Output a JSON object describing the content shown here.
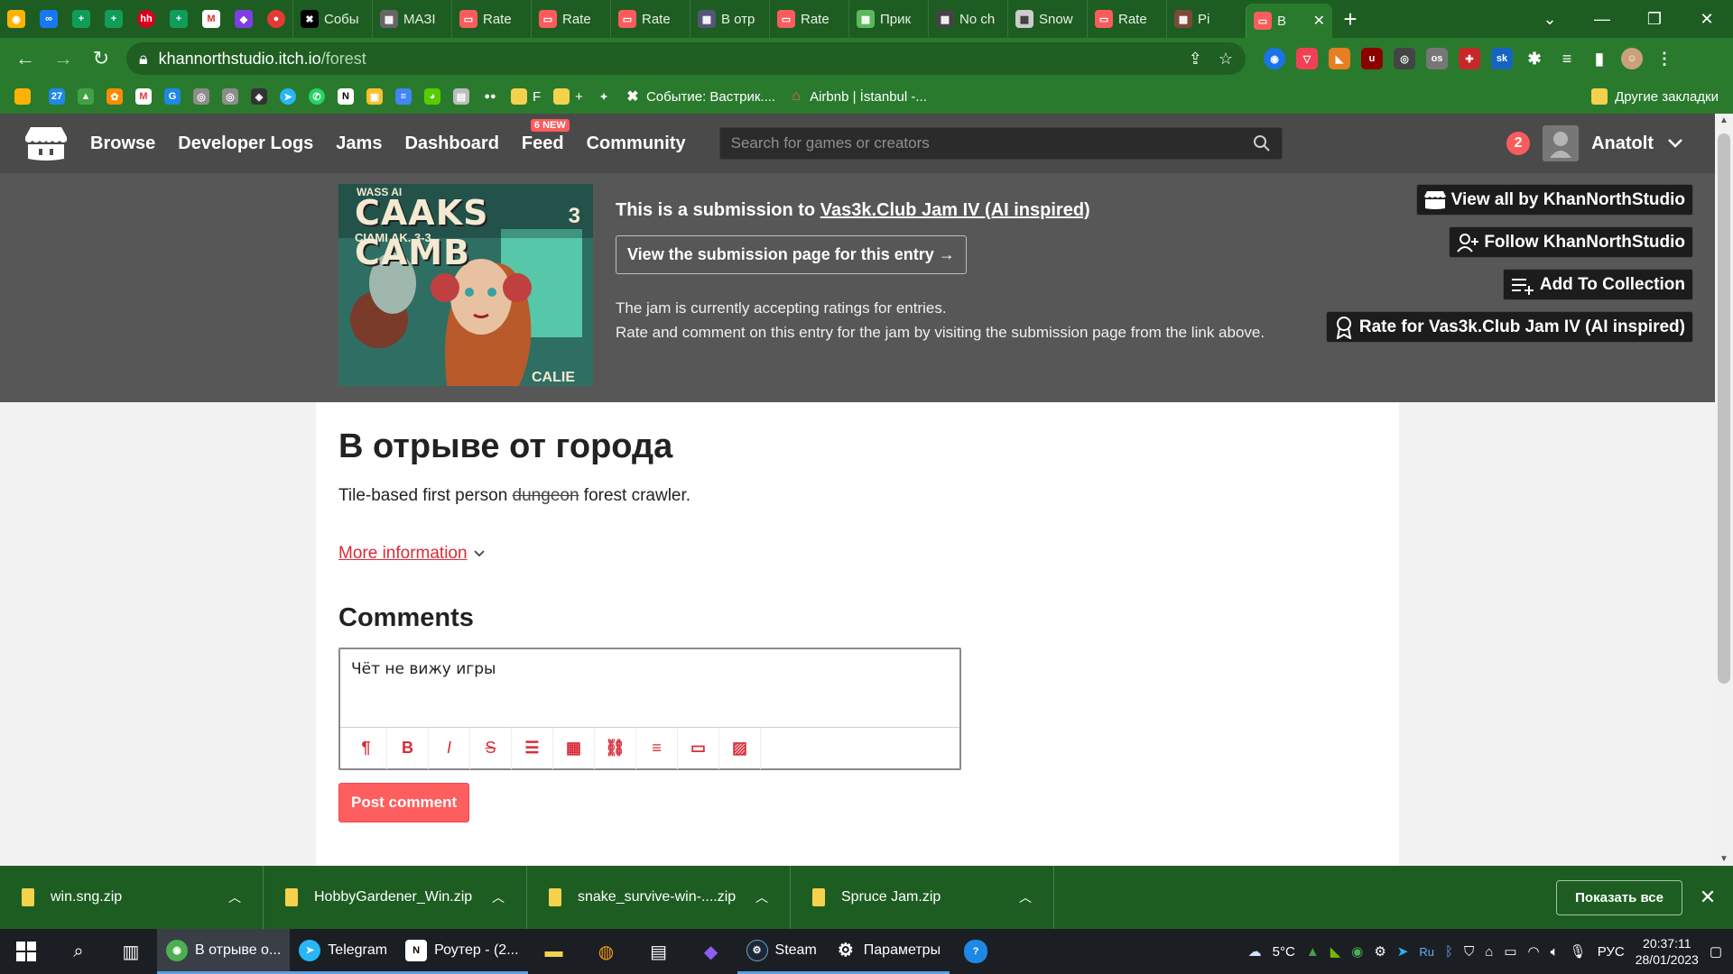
{
  "browser": {
    "pinned_count": 5,
    "tabs": [
      {
        "label": "Собы",
        "icon": "close-icon"
      },
      {
        "label": "МАЗІ",
        "icon": "image-icon"
      },
      {
        "label": "Rate",
        "icon": "itch-icon"
      },
      {
        "label": "Rate",
        "icon": "itch-icon"
      },
      {
        "label": "Rate",
        "icon": "itch-icon"
      },
      {
        "label": "В отр",
        "icon": "image-icon"
      },
      {
        "label": "Rate",
        "icon": "itch-icon"
      },
      {
        "label": "Прик",
        "icon": "image-icon"
      },
      {
        "label": "No ch",
        "icon": "image-icon"
      },
      {
        "label": "Snow",
        "icon": "image-icon"
      },
      {
        "label": "Rate",
        "icon": "itch-icon"
      },
      {
        "label": "Pi",
        "icon": "image-icon"
      },
      {
        "label": "B",
        "icon": "itch-icon",
        "active": true
      }
    ],
    "url_host": "khannorthstudio.itch.io",
    "url_path": "/forest",
    "bookmarks": [
      {
        "label": "",
        "color": "#ffb300"
      },
      {
        "label": "",
        "color": "#1e88e5"
      },
      {
        "label": "",
        "color": "#43a047"
      },
      {
        "label": "",
        "color": "#fb8c00"
      },
      {
        "label": "",
        "color": "#e53935"
      },
      {
        "label": "",
        "color": "#1e88e5"
      },
      {
        "label": "",
        "color": "#8d8d8d"
      },
      {
        "label": "",
        "color": "#8d8d8d"
      },
      {
        "label": "",
        "color": "#333"
      },
      {
        "label": "",
        "color": "#29b6f6"
      },
      {
        "label": "",
        "color": "#25d366"
      },
      {
        "label": "",
        "color": "#000"
      },
      {
        "label": "",
        "color": "#fbc02d"
      },
      {
        "label": "",
        "color": "#4285f4"
      },
      {
        "label": "",
        "color": "#58cc02"
      },
      {
        "label": "",
        "color": "#bdbdbd"
      },
      {
        "label": "",
        "color": "#555"
      },
      {
        "label": "F",
        "color": "#f6d24c"
      },
      {
        "label": "+",
        "color": "#f6d24c"
      },
      {
        "label": "",
        "color": "#888"
      },
      {
        "label": "Событие: Вастрик....",
        "color": "#000"
      },
      {
        "label": "Airbnb | İstanbul -...",
        "color": "#ff5a5f"
      }
    ],
    "other_bookmarks": "Другие закладки"
  },
  "itch": {
    "nav": [
      "Browse",
      "Developer Logs",
      "Jams",
      "Dashboard",
      "Feed",
      "Community"
    ],
    "feed_badge": "6 NEW",
    "search_placeholder": "Search for games or creators",
    "notifications": "2",
    "username": "Anatolt"
  },
  "jam": {
    "cover": {
      "top": "WASS AI",
      "title": "CAAKS CAMB",
      "number": "3",
      "sub": "CIAMI AK. 3-3",
      "bottom": "CALIE"
    },
    "submission_prefix": "This is a submission to ",
    "jam_name": "Vas3k.Club Jam IV (AI inspired)",
    "submission_button": "View the submission page for this entry →",
    "info_line1": "The jam is currently accepting ratings for entries.",
    "info_line2": "Rate and comment on this entry for the jam by visiting the submission page from the link above.",
    "actions": [
      {
        "label": "View all by KhanNorthStudio",
        "icon": "games-icon"
      },
      {
        "label": "Follow KhanNorthStudio",
        "icon": "follow-icon"
      },
      {
        "label": "Add To Collection",
        "icon": "collection-icon"
      },
      {
        "label": "Rate for Vas3k.Club Jam IV (AI inspired)",
        "icon": "award-icon"
      }
    ]
  },
  "game": {
    "title": "В отрыве от города",
    "desc_before": "Tile-based first person ",
    "desc_strike": "dungeon",
    "desc_after": " forest crawler.",
    "more_info": "More information",
    "comments_heading": "Comments",
    "comment_value": "Чёт не вижу игры",
    "post_button": "Post comment"
  },
  "downloads": {
    "items": [
      "win.sng.zip",
      "HobbyGardener_Win.zip",
      "snake_survive-win-....zip",
      "Spruce Jam.zip"
    ],
    "show_all": "Показать все"
  },
  "taskbar": {
    "apps": [
      {
        "label": "В отрыве о...",
        "color": "#4caf50",
        "active": true
      },
      {
        "label": "Telegram",
        "color": "#29b6f6"
      },
      {
        "label": "Роутер - (2...",
        "color": "#ffffff"
      },
      {
        "label": "Steam",
        "color": "#1b2838"
      },
      {
        "label": "Параметры",
        "color": "#888"
      }
    ],
    "weather": "5°C",
    "lang": "РУС",
    "time": "20:37:11",
    "date": "28/01/2023"
  }
}
